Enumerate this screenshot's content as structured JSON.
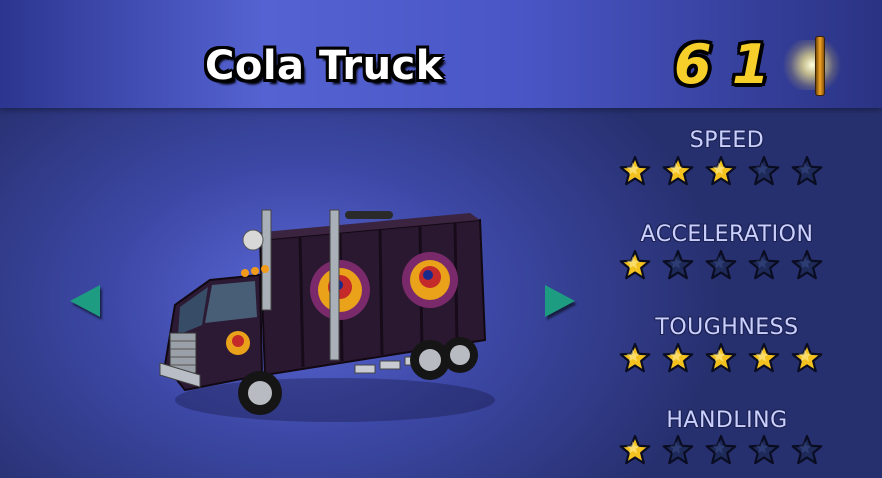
{
  "vehicle": {
    "name": "Cola Truck"
  },
  "coins": {
    "digits": [
      "6",
      "1"
    ]
  },
  "stats": [
    {
      "label": "SPEED",
      "rating": 3,
      "max": 5
    },
    {
      "label": "ACCELERATION",
      "rating": 1,
      "max": 5
    },
    {
      "label": "TOUGHNESS",
      "rating": 5,
      "max": 5
    },
    {
      "label": "HANDLING",
      "rating": 1,
      "max": 5
    }
  ],
  "colors": {
    "star_filled": "#f4c21e",
    "star_empty": "#1e2a5a",
    "arrow": "#1e9c82",
    "coin": "#f7cf2a"
  },
  "icons": {
    "prev": "left-arrow-icon",
    "next": "right-arrow-icon",
    "coin": "coin-icon",
    "star": "star-icon"
  }
}
